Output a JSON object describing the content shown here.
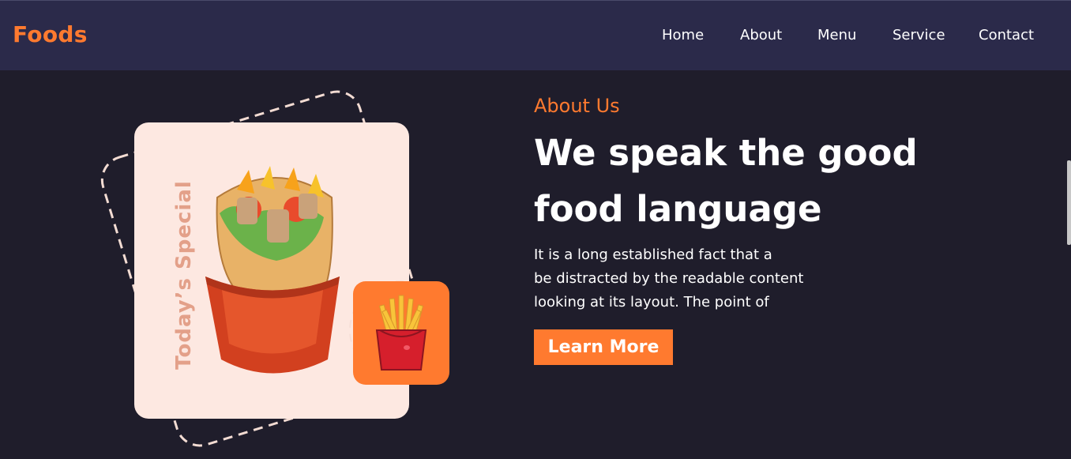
{
  "nav": {
    "brand": "Foods",
    "links": [
      "Home",
      "About",
      "Menu",
      "Service",
      "Contact"
    ]
  },
  "art": {
    "special_label": "Today’s Special"
  },
  "about": {
    "eyebrow": "About Us",
    "headline_line1": "We speak the good",
    "headline_line2": "food language",
    "description_lines": [
      "It is a long established fact that a",
      "be distracted by the readable content",
      "looking at its layout. The point of"
    ],
    "cta_label": "Learn More"
  },
  "colors": {
    "accent": "#ff7a2f",
    "navbar_bg": "#2b2a4a",
    "page_bg": "#1f1d2b",
    "card_bg": "#fde8e1"
  }
}
